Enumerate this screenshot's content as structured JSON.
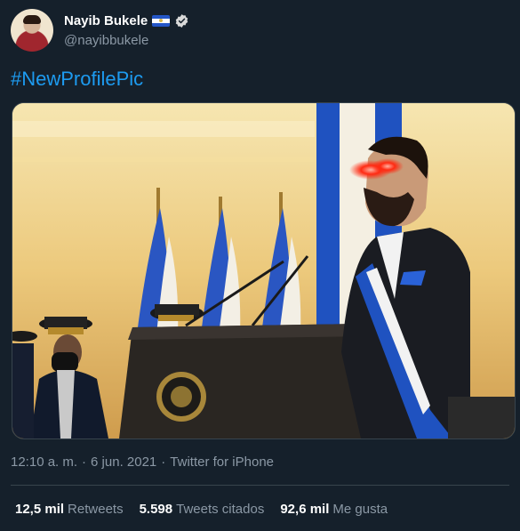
{
  "author": {
    "display_name": "Nayib Bukele",
    "handle": "@nayibbukele",
    "verified_icon": "verified-badge-icon",
    "flag_icon": "el-salvador-flag-icon"
  },
  "tweet": {
    "text": "#NewProfilePic",
    "time": "12:10 a. m.",
    "date": "6 jun. 2021",
    "source": "Twitter for iPhone",
    "separator": "·"
  },
  "stats": {
    "retweets_count": "12,5 mil",
    "retweets_label": "Retweets",
    "quotes_count": "5.598",
    "quotes_label": "Tweets citados",
    "likes_count": "92,6 mil",
    "likes_label": "Me gusta"
  },
  "colors": {
    "background": "#15202b",
    "link": "#1d9bf0",
    "muted": "#8b98a5",
    "divider": "#38444d"
  }
}
